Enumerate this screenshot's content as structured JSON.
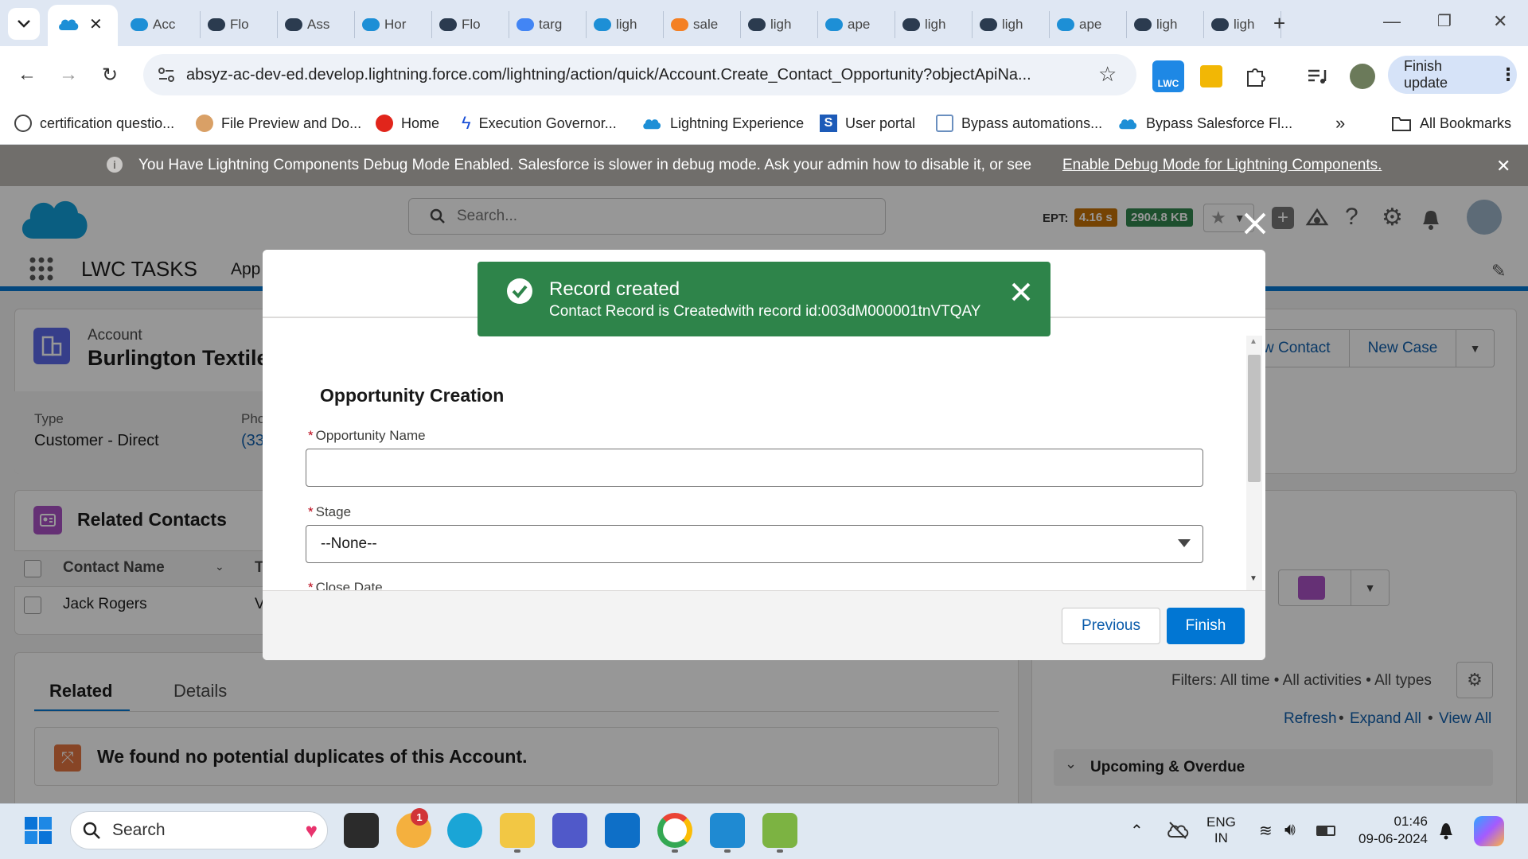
{
  "browser": {
    "tabs": [
      {
        "label": "Acc"
      },
      {
        "label": "Flo"
      },
      {
        "label": "Ass"
      },
      {
        "label": "Hor"
      },
      {
        "label": "Flo"
      },
      {
        "label": "targ"
      },
      {
        "label": "ligh"
      },
      {
        "label": "sale"
      },
      {
        "label": "ligh"
      },
      {
        "label": "ape"
      },
      {
        "label": "ligh"
      },
      {
        "label": "ligh"
      },
      {
        "label": "ape"
      },
      {
        "label": "ligh"
      },
      {
        "label": "ligh"
      }
    ],
    "url": "absyz-ac-dev-ed.develop.lightning.force.com/lightning/action/quick/Account.Create_Contact_Opportunity?objectApiNa...",
    "finish_update_label": "Finish update",
    "bookmarks": [
      "certification questio...",
      "File Preview and Do...",
      "Home",
      "Execution Governor...",
      "Lightning Experience",
      "User portal",
      "Bypass automations...",
      "Bypass Salesforce Fl..."
    ],
    "more_bookmarks": "»",
    "all_bookmarks": "All Bookmarks"
  },
  "salesforce": {
    "debug_banner": {
      "text": "You Have Lightning Components Debug Mode Enabled. Salesforce is slower in debug mode. Ask your admin how to disable it, or see",
      "link": "Enable Debug Mode for Lightning Components."
    },
    "search_placeholder": "Search...",
    "ept": {
      "label": "EPT:",
      "time": "4.16 s",
      "size": "2904.8 KB"
    },
    "app_name": "LWC TASKS",
    "nav_item": "App",
    "record": {
      "object": "Account",
      "name": "Burlington Textile",
      "type_label": "Type",
      "type_value": "Customer - Direct",
      "phone_label": "Pho",
      "phone_value": "(33"
    },
    "actions": {
      "new_contact": "w Contact",
      "new_case": "New Case"
    },
    "related_contacts": {
      "title": "Related Contacts",
      "col_name": "Contact Name",
      "col_title": "T",
      "rows": [
        {
          "name": "Jack Rogers",
          "title": "V"
        }
      ]
    },
    "tabs": {
      "related": "Related",
      "details": "Details"
    },
    "duplicates_text": "We found no potential duplicates of this Account.",
    "activity": {
      "filters": "Filters: All time • All activities • All types",
      "refresh": "Refresh",
      "expand_all": "Expand All",
      "view_all": "View All",
      "upcoming": "Upcoming & Overdue"
    }
  },
  "modal": {
    "toast": {
      "title": "Record created",
      "message": "Contact Record is Createdwith record id:003dM000001tnVTQAY"
    },
    "form_title": "Opportunity Creation",
    "fields": {
      "opportunity_name_label": "Opportunity Name",
      "opportunity_name_value": "",
      "stage_label": "Stage",
      "stage_value": "--None--",
      "close_date_label": "Close Date"
    },
    "buttons": {
      "previous": "Previous",
      "finish": "Finish"
    }
  },
  "taskbar": {
    "search_placeholder": "Search",
    "notification_badge": "1",
    "language_top": "ENG",
    "language_bottom": "IN",
    "time": "01:46",
    "date": "09-06-2024"
  }
}
